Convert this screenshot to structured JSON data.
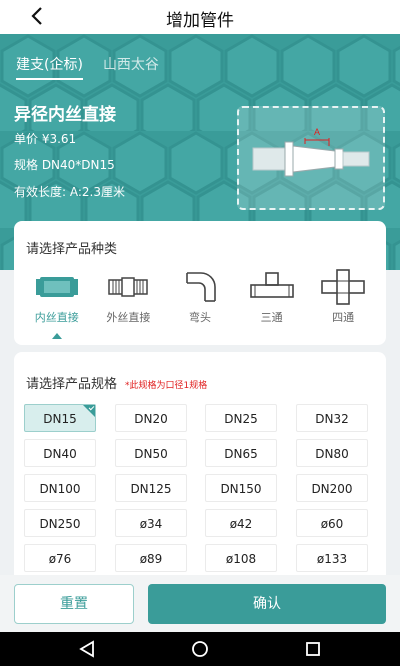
{
  "header": {
    "title": "增加管件"
  },
  "tabs": [
    {
      "label": "建支(企标)",
      "active": true
    },
    {
      "label": "山西太谷",
      "active": false
    }
  ],
  "product": {
    "name": "异径内丝直接",
    "price": "单价 ¥3.61",
    "spec": "规格 DN40*DN15",
    "length": "有效长度: A:2.3厘米",
    "diagram_label": "A"
  },
  "type_section": {
    "title": "请选择产品种类",
    "items": [
      {
        "label": "内丝直接",
        "icon": "inner-thread-coupling-icon",
        "selected": true
      },
      {
        "label": "外丝直接",
        "icon": "outer-thread-coupling-icon",
        "selected": false
      },
      {
        "label": "弯头",
        "icon": "elbow-icon",
        "selected": false
      },
      {
        "label": "三通",
        "icon": "tee-icon",
        "selected": false
      },
      {
        "label": "四通",
        "icon": "cross-icon",
        "selected": false
      }
    ]
  },
  "spec_section": {
    "title": "请选择产品规格",
    "note": "*此规格为口径1规格",
    "options": [
      "DN15",
      "DN20",
      "DN25",
      "DN32",
      "DN40",
      "DN50",
      "DN65",
      "DN80",
      "DN100",
      "DN125",
      "DN150",
      "DN200",
      "DN250",
      "ø34",
      "ø42",
      "ø60",
      "ø76",
      "ø89",
      "ø108",
      "ø133"
    ],
    "selected": "DN15"
  },
  "actions": {
    "reset": "重置",
    "confirm": "确认"
  },
  "colors": {
    "accent": "#3a9c99",
    "accent_light": "#d8eeed",
    "warning": "#e02020"
  },
  "system_nav": {
    "icons": [
      "back-triangle-icon",
      "home-circle-icon",
      "recents-square-icon"
    ]
  }
}
